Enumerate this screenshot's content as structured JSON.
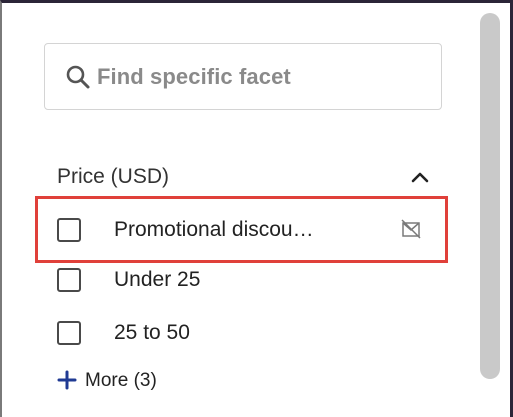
{
  "search": {
    "placeholder": "Find specific facet",
    "icon": "search-icon"
  },
  "facet": {
    "title": "Price (USD)",
    "collapse_icon": "chevron-up-icon",
    "items": [
      {
        "label": "Promotional discou…",
        "checked": false,
        "highlighted": true,
        "icon": "exclude-icon"
      },
      {
        "label": "Under 25",
        "checked": false
      },
      {
        "label": "25 to 50",
        "checked": false
      }
    ],
    "more_label": "More (3)",
    "more_icon": "plus-icon"
  },
  "colors": {
    "highlight": "#e0403a",
    "accent": "#1f3a93",
    "scrollbar": "#c9c9c9"
  }
}
